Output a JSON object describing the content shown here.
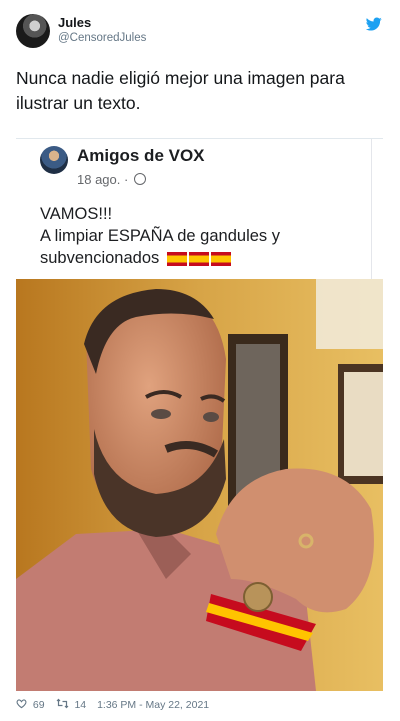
{
  "author": {
    "display_name": "Jules",
    "handle": "@CensoredJules"
  },
  "tweet": {
    "text": "Nunca nadie eligió mejor una imagen para ilustrar un texto."
  },
  "embedded_post": {
    "page_name": "Amigos de VOX",
    "date": "18 ago. ·",
    "line1": "VAMOS!!!",
    "line2": "A limpiar ESPAÑA de gandules y",
    "line3": "subvencionados"
  },
  "footer": {
    "likes": "69",
    "retweets": "14",
    "timestamp": "1:36 PM - May 22, 2021"
  },
  "icons": {
    "twitter": "twitter-bird-icon",
    "like": "heart-icon",
    "retweet": "retweet-icon",
    "globe": "globe-icon"
  },
  "colors": {
    "twitter_blue": "#1da1f2",
    "text_secondary": "#657786"
  }
}
